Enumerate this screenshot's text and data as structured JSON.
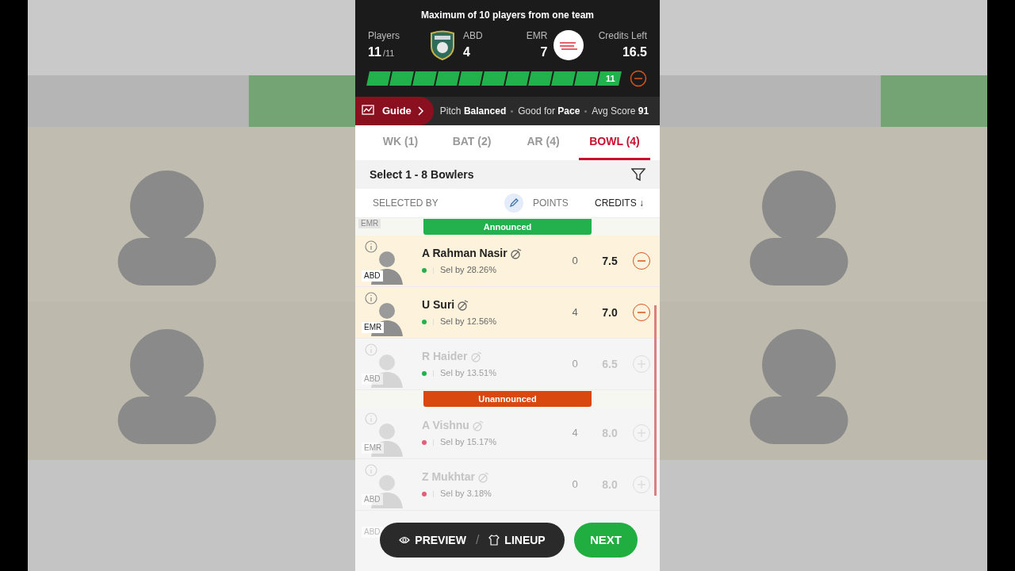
{
  "header": {
    "notice": "Maximum of 10 players from one team",
    "players_label": "Players",
    "players_count": "11",
    "players_max": "/11",
    "team_a": {
      "name": "ABD",
      "count": "4"
    },
    "team_b": {
      "name": "EMR",
      "count": "7"
    },
    "credits_label": "Credits Left",
    "credits": "16.5",
    "progress": {
      "level": 1,
      "label": "11"
    }
  },
  "guide": {
    "label": "Guide",
    "facts": [
      {
        "label": "Pitch",
        "value": "Balanced"
      },
      {
        "label": "Good for",
        "value": "Pace"
      },
      {
        "label": "Avg Score",
        "value": "91"
      }
    ]
  },
  "tabs": [
    {
      "label": "WK (1)",
      "selected": false
    },
    {
      "label": "BAT (2)",
      "selected": false
    },
    {
      "label": "AR (4)",
      "selected": false
    },
    {
      "label": "BOWL (4)",
      "selected": true
    }
  ],
  "instruction": "Select 1 - 8 Bowlers",
  "columns": {
    "selected_by": "SELECTED BY",
    "points": "POINTS",
    "credits": "CREDITS ↓"
  },
  "groups": [
    {
      "title": "Announced",
      "color": "#22b14c",
      "top_tag": "EMR",
      "players": [
        {
          "name": "A Rahman Nasir",
          "team": "ABD",
          "sel": "Sel by 28.26%",
          "points": "0",
          "credits": "7.5",
          "selected": true,
          "disabled": false,
          "color": "#22b14c"
        },
        {
          "name": "U Suri",
          "team": "EMR",
          "sel": "Sel by 12.56%",
          "points": "4",
          "credits": "7.0",
          "selected": true,
          "disabled": false,
          "color": "#22b14c"
        },
        {
          "name": "R Haider",
          "team": "ABD",
          "sel": "Sel by 13.51%",
          "points": "0",
          "credits": "6.5",
          "selected": false,
          "disabled": true,
          "color": "#22b14c"
        }
      ]
    },
    {
      "title": "Unannounced",
      "color": "#d9480f",
      "players": [
        {
          "name": "A Vishnu",
          "team": "EMR",
          "sel": "Sel by 15.17%",
          "points": "4",
          "credits": "8.0",
          "selected": false,
          "disabled": true,
          "color": "#e0607a"
        },
        {
          "name": "Z Mukhtar",
          "team": "ABD",
          "sel": "Sel by 3.18%",
          "points": "0",
          "credits": "8.0",
          "selected": false,
          "disabled": true,
          "color": "#e0607a"
        }
      ]
    }
  ],
  "hidden_row_tag": "ABD",
  "bottom": {
    "preview": "PREVIEW",
    "separator": "/",
    "lineup": "LINEUP",
    "next": "NEXT"
  }
}
